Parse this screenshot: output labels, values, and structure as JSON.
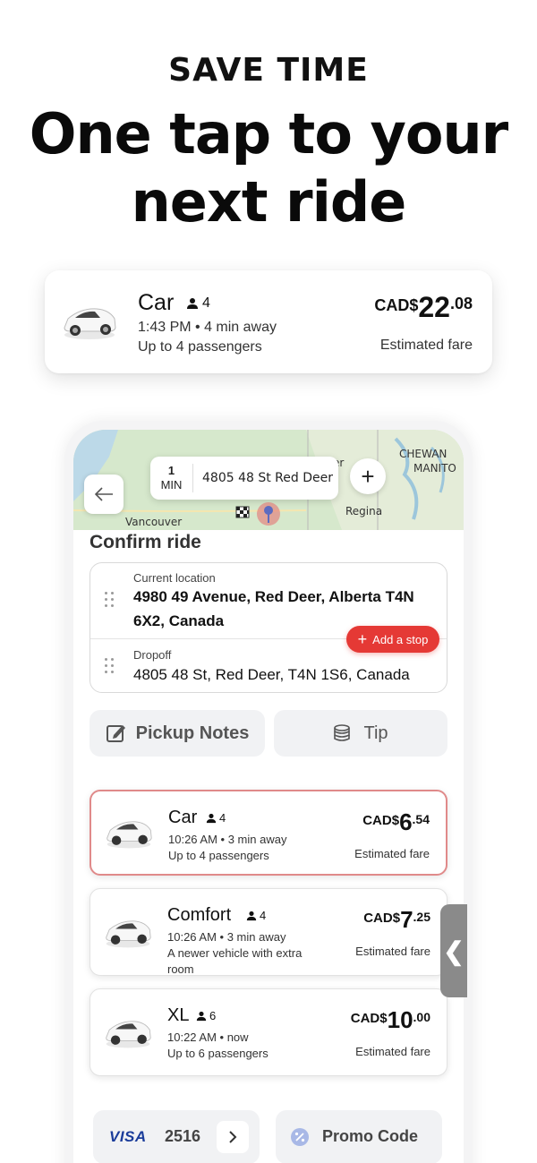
{
  "hero": {
    "kicker": "SAVE TIME",
    "title_line1": "One tap to your",
    "title_line2": "next ride"
  },
  "featured_card": {
    "name": "Car",
    "seats": "4",
    "time_line": "1:43 PM • 4 min away",
    "passengers": "Up to 4 passengers",
    "currency": "CAD$",
    "price_main": "22",
    "price_cents": ".08",
    "fare_label": "Estimated fare"
  },
  "map": {
    "eta_value": "1",
    "eta_unit": "MIN",
    "eta_address": "4805 48 St Red Deer",
    "labels": {
      "sask": "CHEWAN",
      "manitoba": "MANITO",
      "regina": "Regina",
      "vancouver": "Vancouver",
      "er": "er"
    }
  },
  "confirm": {
    "title": "Confirm ride",
    "pickup_label": "Current location",
    "pickup_line1": "4980 49 Avenue, Red Deer, Alberta T4N",
    "pickup_line2": "6X2, Canada",
    "dropoff_label": "Dropoff",
    "dropoff_value": "4805 48 St, Red Deer, T4N 1S6, Canada",
    "add_stop": "Add a stop",
    "pickup_notes": "Pickup Notes",
    "tip": "Tip"
  },
  "rides": [
    {
      "name": "Car",
      "seats": "4",
      "line1": "10:26 AM • 3 min away",
      "line2": "Up to 4 passengers",
      "line3": "",
      "currency": "CAD$",
      "price_main": "6",
      "price_cents": ".54",
      "fare_label": "Estimated fare",
      "selected": true
    },
    {
      "name": "Comfort",
      "seats": "4",
      "line1": "10:26 AM • 3 min away",
      "line2": "A newer vehicle with extra",
      "line3": "room",
      "currency": "CAD$",
      "price_main": "7",
      "price_cents": ".25",
      "fare_label": "Estimated fare",
      "selected": false
    },
    {
      "name": "XL",
      "seats": "6",
      "line1": "10:22 AM • now",
      "line2": "Up to 6 passengers",
      "line3": "",
      "currency": "CAD$",
      "price_main": "10",
      "price_cents": ".00",
      "fare_label": "Estimated fare",
      "selected": false
    }
  ],
  "payment": {
    "brand": "VISA",
    "last4": "2516",
    "promo": "Promo Code"
  },
  "colors": {
    "accent_red": "#e53935",
    "visa_blue": "#1a3c9a"
  }
}
